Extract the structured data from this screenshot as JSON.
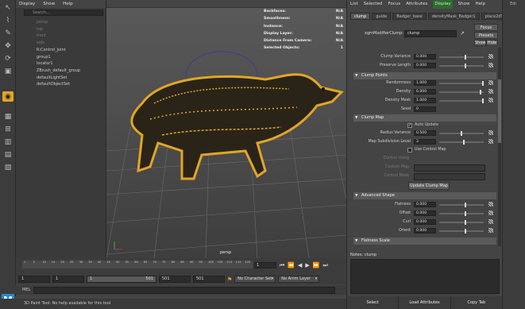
{
  "outliner": {
    "menu": [
      "Display",
      "Show",
      "Help"
    ],
    "search_placeholder": "Search...",
    "items": [
      {
        "label": "persp",
        "dim": true
      },
      {
        "label": "top",
        "dim": true
      },
      {
        "label": "front",
        "dim": true
      },
      {
        "label": "side",
        "dim": true
      },
      {
        "label": "R:Control_Joint",
        "dim": false
      },
      {
        "label": "group1",
        "dim": false
      },
      {
        "label": "locator1",
        "dim": false
      },
      {
        "label": "ZBrush_default_group",
        "dim": false
      },
      {
        "label": "defaultLightSet",
        "dim": false
      },
      {
        "label": "defaultObjectSet",
        "dim": false
      }
    ]
  },
  "viewport": {
    "hud": [
      {
        "label": "Backfaces:",
        "value": "N/A"
      },
      {
        "label": "Smoothness:",
        "value": "N/A"
      },
      {
        "label": "Instance:",
        "value": "N/A"
      },
      {
        "label": "Display Layer:",
        "value": "N/A"
      },
      {
        "label": "Distance From Camera:",
        "value": "N/A"
      },
      {
        "label": "Selected Objects:",
        "value": "1"
      }
    ],
    "camera_label": "persp"
  },
  "timeline": {
    "ticks": [
      "1",
      "5",
      "10",
      "15",
      "20",
      "25",
      "30",
      "35",
      "40",
      "45",
      "50",
      "55",
      "60",
      "65",
      "70",
      "75",
      "80",
      "85",
      "90",
      "95",
      "100",
      "105",
      "110",
      "115",
      "120"
    ],
    "current_frame": "1",
    "range": {
      "start": "1",
      "inner_start": "1",
      "slider_start": "1",
      "slider_end": "501",
      "inner_end": "501",
      "end": "501"
    },
    "character_set": "No Character Set",
    "anim_layer": "No Anim Layer"
  },
  "mel_label": "MEL",
  "help_text": "3D Paint Tool: No help available for this tool",
  "attribute_editor": {
    "menu": [
      "List",
      "Selected",
      "Focus",
      "Attributes",
      "Display",
      "Show",
      "Help"
    ],
    "menu_active": "Display",
    "tabs": [
      "clump",
      "guide",
      "Badger_base",
      "densityMask_Badger1",
      "place2dTexture1"
    ],
    "active_tab": "clump",
    "node_type_label": "xgmModifierClump:",
    "node_name": "clump",
    "focus_label": "Focus",
    "presets_label": "Presets",
    "show_label": "Show",
    "hide_label": "Hide",
    "top_rows": [
      {
        "label": "Clump Variance",
        "value": "0.000",
        "level": 0.6
      },
      {
        "label": "Preserve Length",
        "value": "0.000",
        "level": 0.6
      }
    ],
    "clump_points": {
      "title": "Clump Points",
      "rows": [
        {
          "label": "Randomness",
          "value": "1.000",
          "level": 1.0
        },
        {
          "label": "Density",
          "value": "6.000",
          "level": 0.95
        },
        {
          "label": "Density Mask",
          "value": "1.000",
          "level": 1.0
        },
        {
          "label": "Seed",
          "value": "0",
          "level": null
        }
      ]
    },
    "clump_map": {
      "title": "Clump Map",
      "auto_update_label": "Auto Update",
      "auto_update": true,
      "radius_label": "Radius Variance",
      "radius_value": "0.500",
      "radius_level": 0.5,
      "subdiv_label": "Map Subdivision Level",
      "subdiv_value": "3",
      "subdiv_level": 0.55,
      "use_control_map_label": "Use Control Map",
      "use_control_map": false,
      "control_using_label": "Control Using",
      "control_using_value": "Cluster Map",
      "custom_map_label": "Custom Map",
      "control_mask_label": "Control Mask",
      "update_button": "Update Clump Map"
    },
    "advanced_shape": {
      "title": "Advanced Shape",
      "rows": [
        {
          "label": "Flatness",
          "value": "0.000",
          "level": 0.6
        },
        {
          "label": "Offset",
          "value": "0.000",
          "level": 0.6
        },
        {
          "label": "Curl",
          "value": "0.000",
          "level": 0.6
        },
        {
          "label": "Orient",
          "value": "0.000",
          "level": 0.6
        }
      ]
    },
    "flatness_scale_title": "Flatness Scale",
    "notes_label": "Notes: clump",
    "footer": [
      "Select",
      "Load Attributes",
      "Copy Tab"
    ]
  },
  "shelf_right": [
    "Edi",
    "",
    "",
    "",
    "",
    "",
    "",
    "",
    "",
    "",
    "",
    "",
    "",
    "",
    "",
    "",
    ""
  ],
  "colors": {
    "fur": "#e2a623",
    "fur_dark": "#2a2418",
    "curve": "#3a34a8",
    "accent": "#4aa3d3"
  }
}
